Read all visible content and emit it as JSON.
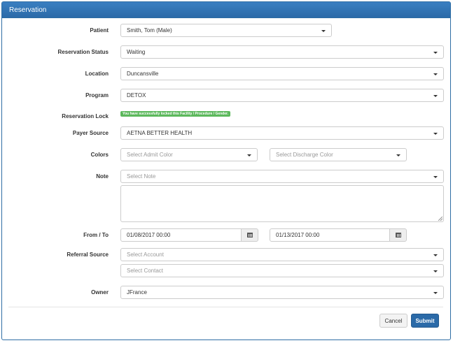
{
  "panel": {
    "title": "Reservation"
  },
  "fields": {
    "patient": {
      "label": "Patient",
      "value": "Smith, Tom (Male)"
    },
    "reservation_status": {
      "label": "Reservation Status",
      "value": "Waiting"
    },
    "location": {
      "label": "Location",
      "value": "Duncansville"
    },
    "program": {
      "label": "Program",
      "value": "DETOX"
    },
    "reservation_lock": {
      "label": "Reservation Lock",
      "message": "You have successfully locked this Facility / Procedure / Gender."
    },
    "payer_source": {
      "label": "Payer Source",
      "value": "AETNA BETTER HEALTH"
    },
    "colors": {
      "label": "Colors",
      "admit_placeholder": "Select Admit Color",
      "discharge_placeholder": "Select Discharge Color"
    },
    "note": {
      "label": "Note",
      "placeholder": "Select Note",
      "text": ""
    },
    "from_to": {
      "label": "From / To",
      "from": "01/08/2017 00:00",
      "to": "01/13/2017 00:00"
    },
    "referral_source": {
      "label": "Referral Source",
      "account_placeholder": "Select Account",
      "contact_placeholder": "Select Contact"
    },
    "owner": {
      "label": "Owner",
      "value": "JFrance"
    }
  },
  "buttons": {
    "cancel": "Cancel",
    "submit": "Submit"
  },
  "colors": {
    "primary": "#2b6aa8",
    "success": "#5cb85c"
  }
}
